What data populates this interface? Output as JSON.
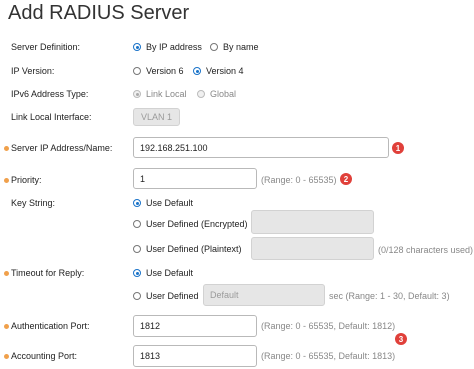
{
  "title": "Add RADIUS Server",
  "server_definition": {
    "label": "Server Definition:",
    "options": [
      "By IP address",
      "By name"
    ],
    "selected": "By IP address"
  },
  "ip_version": {
    "label": "IP Version:",
    "options": [
      "Version 6",
      "Version 4"
    ],
    "selected": "Version 4"
  },
  "ipv6_type": {
    "label": "IPv6 Address Type:",
    "options": [
      "Link Local",
      "Global"
    ],
    "selected": "Link Local"
  },
  "link_local_interface": {
    "label": "Link Local Interface:",
    "value": "VLAN 1"
  },
  "server_ip": {
    "label": "Server IP Address/Name:",
    "value": "192.168.251.100",
    "badge": "1"
  },
  "priority": {
    "label": "Priority:",
    "value": "1",
    "hint": "(Range: 0 - 65535)",
    "badge": "2"
  },
  "key_string": {
    "label": "Key String:",
    "options": [
      "Use Default",
      "User Defined (Encrypted)",
      "User Defined (Plaintext)"
    ],
    "selected": "Use Default",
    "plaintext_hint": "(0/128 characters used)"
  },
  "timeout": {
    "label": "Timeout for Reply:",
    "options": [
      "Use Default",
      "User Defined"
    ],
    "selected": "Use Default",
    "placeholder": "Default",
    "hint": "sec (Range: 1 - 30, Default: 3)"
  },
  "auth_port": {
    "label": "Authentication Port:",
    "value": "1812",
    "hint": "(Range: 0 - 65535, Default: 1812)",
    "badge": "3"
  },
  "acct_port": {
    "label": "Accounting Port:",
    "value": "1813",
    "hint": "(Range: 0 - 65535, Default: 1813)"
  },
  "colors": {
    "accent": "#1a73c9",
    "required_dot": "#f0a04b",
    "badge": "#e0403a"
  }
}
